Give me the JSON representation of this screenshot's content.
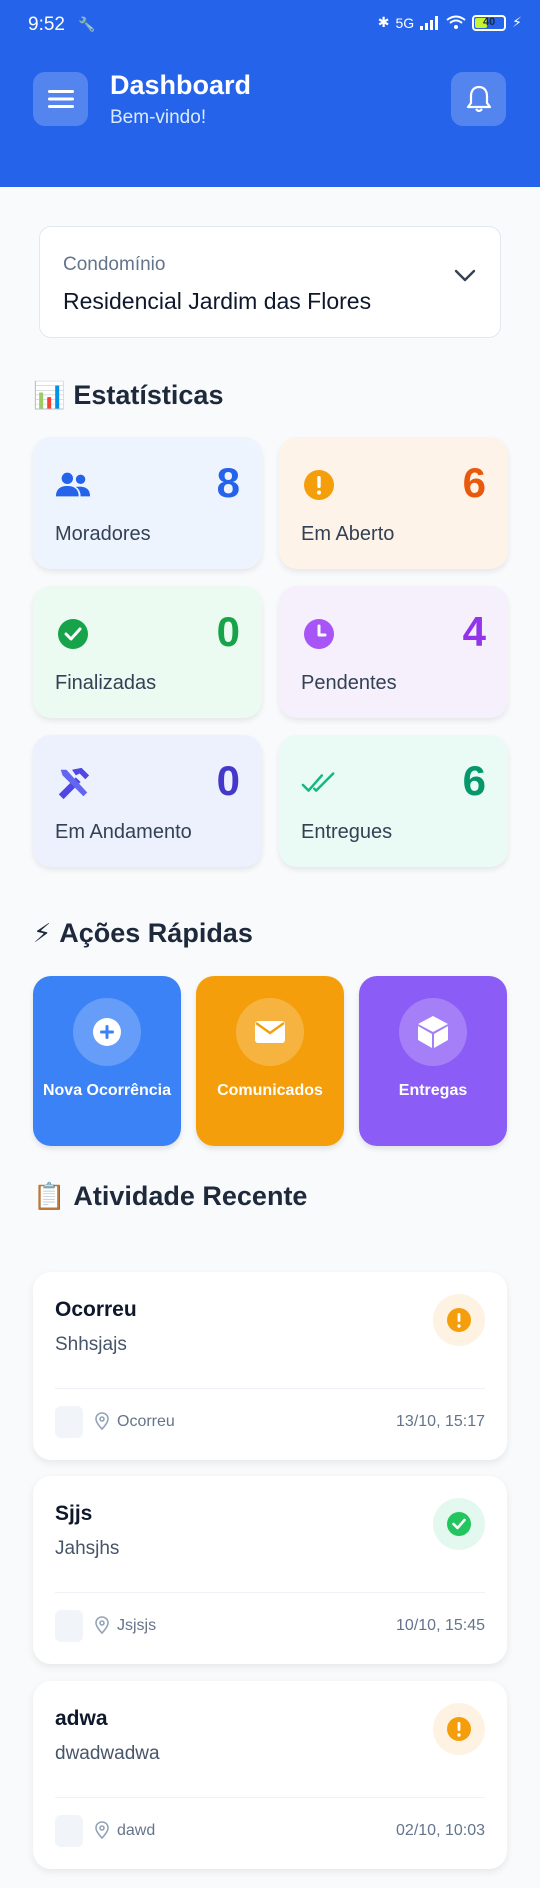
{
  "status_bar": {
    "time": "9:52",
    "network": "5G",
    "battery": "40"
  },
  "header": {
    "title": "Dashboard",
    "subtitle": "Bem-vindo!"
  },
  "condo_select": {
    "label": "Condomínio",
    "value": "Residencial Jardim das Flores"
  },
  "stats_section": {
    "emoji": "📊",
    "title": "Estatísticas"
  },
  "stats": [
    {
      "label": "Moradores",
      "value": "8",
      "icon": "users-icon",
      "color": "#2563eb",
      "bg": "#eef4fe"
    },
    {
      "label": "Em Aberto",
      "value": "6",
      "icon": "alert-circle-icon",
      "color": "#ea580c",
      "bg": "#fef3e8"
    },
    {
      "label": "Finalizadas",
      "value": "0",
      "icon": "check-circle-icon",
      "color": "#16a34a",
      "bg": "#ecfbf1"
    },
    {
      "label": "Pendentes",
      "value": "4",
      "icon": "clock-icon",
      "color": "#9333ea",
      "bg": "#f6f0fd"
    },
    {
      "label": "Em Andamento",
      "value": "0",
      "icon": "tools-icon",
      "color": "#4338ca",
      "bg": "#edf0fd"
    },
    {
      "label": "Entregues",
      "value": "6",
      "icon": "double-check-icon",
      "color": "#059669",
      "bg": "#e9fbf4"
    }
  ],
  "quick_section": {
    "emoji": "⚡",
    "title": "Ações Rápidas"
  },
  "quick_actions": [
    {
      "label": "Nova Ocorrência",
      "icon": "plus-circle-icon",
      "color": "#3b82f6"
    },
    {
      "label": "Comunicados",
      "icon": "envelope-icon",
      "color": "#f59e0b"
    },
    {
      "label": "Entregas",
      "icon": "package-icon",
      "color": "#8b5cf6"
    }
  ],
  "activity_section": {
    "emoji": "📋",
    "title": "Atividade Recente"
  },
  "activities": [
    {
      "title": "Ocorreu",
      "description": "Shhsjajs",
      "location": "Ocorreu",
      "time": "13/10, 15:17",
      "status": "alert-icon"
    },
    {
      "title": "Sjjs",
      "description": "Jahsjhs",
      "location": "Jsjsjs",
      "time": "10/10, 15:45",
      "status": "check-icon"
    },
    {
      "title": "adwa",
      "description": "dwadwadwa",
      "location": "dawd",
      "time": "02/10, 10:03",
      "status": "alert-icon"
    }
  ]
}
